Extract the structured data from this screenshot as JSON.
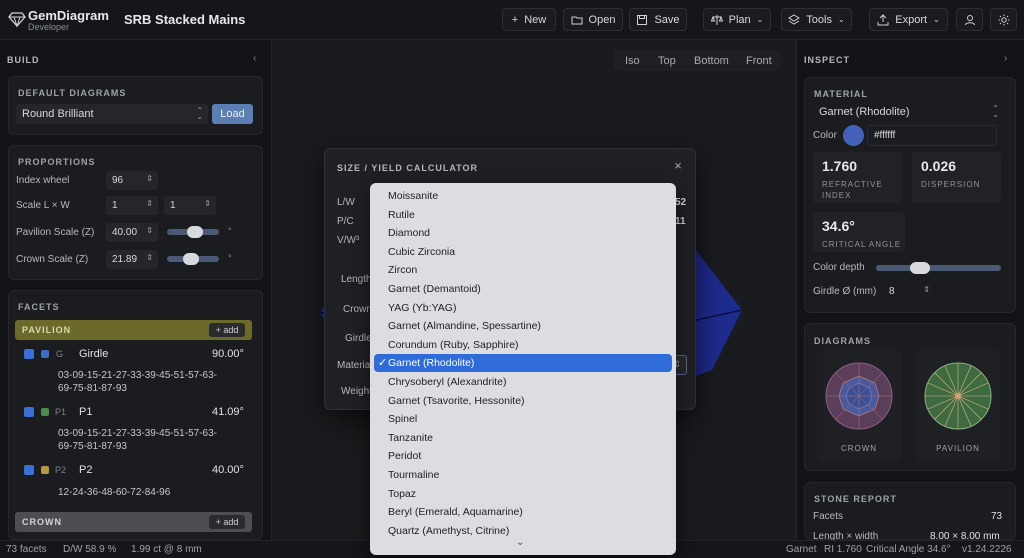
{
  "app": {
    "name": "GemDiagram",
    "subtitle": "Developer",
    "document_title": "SRB Stacked Mains"
  },
  "toolbar": {
    "new_label": "New",
    "open_label": "Open",
    "save_label": "Save",
    "plan_label": "Plan",
    "tools_label": "Tools",
    "export_label": "Export"
  },
  "left_sidebar": {
    "header": "BUILD",
    "default_diagrams": {
      "title": "DEFAULT DIAGRAMS",
      "selected": "Round Brilliant",
      "load_label": "Load"
    },
    "proportions": {
      "title": "PROPORTIONS",
      "index_wheel_label": "Index wheel",
      "index_wheel_value": "96",
      "scale_lw_label": "Scale L × W",
      "scale_l_value": "1",
      "scale_w_value": "1",
      "pavilion_scale_label": "Pavilion Scale (Z)",
      "pavilion_scale_value": "40.00",
      "pavilion_slider_fraction": 0.55,
      "crown_scale_label": "Crown Scale (Z)",
      "crown_scale_value": "21.89",
      "crown_slider_fraction": 0.45,
      "degree_symbol": "°"
    },
    "facets": {
      "title": "FACETS",
      "add_label": "+ add",
      "groups": [
        {
          "name": "PAVILION",
          "items": [
            {
              "code": "G",
              "name": "Girdle",
              "angle": "90.00°",
              "sequence_1": "03-09-15-21-27-33-39-45-51-57-63-",
              "sequence_2": "69-75-81-87-93",
              "color": "#3f6cc4"
            },
            {
              "code": "P1",
              "name": "P1",
              "angle": "41.09°",
              "sequence_1": "03-09-15-21-27-33-39-45-51-57-63-",
              "sequence_2": "69-75-81-87-93",
              "color": "#4a8c4a"
            },
            {
              "code": "P2",
              "name": "P2",
              "angle": "40.00°",
              "sequence_1": "12-24-36-48-60-72-84-96",
              "sequence_2": "",
              "color": "#b39840"
            }
          ]
        },
        {
          "name": "CROWN",
          "items": []
        }
      ]
    }
  },
  "viewport": {
    "view_tabs": [
      "Iso",
      "Top",
      "Bottom",
      "Front"
    ]
  },
  "right_sidebar": {
    "header": "INSPECT",
    "material": {
      "title": "MATERIAL",
      "selected": "Garnet (Rhodolite)",
      "color_label": "Color",
      "color_value": "#ffffff",
      "refractive_index_value": "1.760",
      "refractive_index_label": "REFRACTIVE INDEX",
      "dispersion_value": "0.026",
      "dispersion_label": "DISPERSION",
      "critical_angle_value": "34.6°",
      "critical_angle_label": "CRITICAL ANGLE",
      "color_depth_label": "Color depth",
      "color_depth_fraction": 0.32,
      "girdle_label": "Girdle Ø (mm)",
      "girdle_value": "8"
    },
    "diagrams": {
      "title": "DIAGRAMS",
      "crown_label": "CROWN",
      "pavilion_label": "PAVILION"
    },
    "stone_report": {
      "title": "STONE REPORT",
      "facets_label": "Facets",
      "facets_value": "73",
      "length_label": "Length × width",
      "length_value": "8.00 × 8.00 mm"
    }
  },
  "status_bar": {
    "facets": "73 facets",
    "dw": "D/W 58.9 %",
    "carat": "1.99 ct @ 8 mm",
    "material": "Garnet",
    "ri": "RI 1.760",
    "critical": "Critical Angle 34.6°",
    "version": "v1.24.2226"
  },
  "modal": {
    "title": "SIZE / YIELD CALCULATOR",
    "close_label": "×",
    "lw_label": "L/W",
    "lw_value": "52",
    "pc_label": "P/C",
    "pc_value": "11",
    "vw_label": "V/W³",
    "length_label": "Length",
    "crown_label": "Crown",
    "girdle_label": "Girdle",
    "material_label": "Material",
    "weight_label": "Weight"
  },
  "material_dropdown": {
    "selected": "Garnet (Rhodolite)",
    "options": [
      "Moissanite",
      "Rutile",
      "Diamond",
      "Cubic Zirconia",
      "Zircon",
      "Garnet (Demantoid)",
      "YAG (Yb:YAG)",
      "Garnet (Almandine, Spessartine)",
      "Corundum (Ruby, Sapphire)",
      "Garnet (Rhodolite)",
      "Chrysoberyl (Alexandrite)",
      "Garnet (Tsavorite, Hessonite)",
      "Spinel",
      "Tanzanite",
      "Peridot",
      "Tourmaline",
      "Topaz",
      "Beryl (Emerald, Aquamarine)",
      "Quartz (Amethyst, Citrine)"
    ],
    "checkmark": "✓"
  },
  "colors": {
    "accent": "#2f6bd9",
    "pavilion_bar": "#6b6a2a",
    "crown_bar": "#4d4e52",
    "gem": "#2a3db8"
  }
}
